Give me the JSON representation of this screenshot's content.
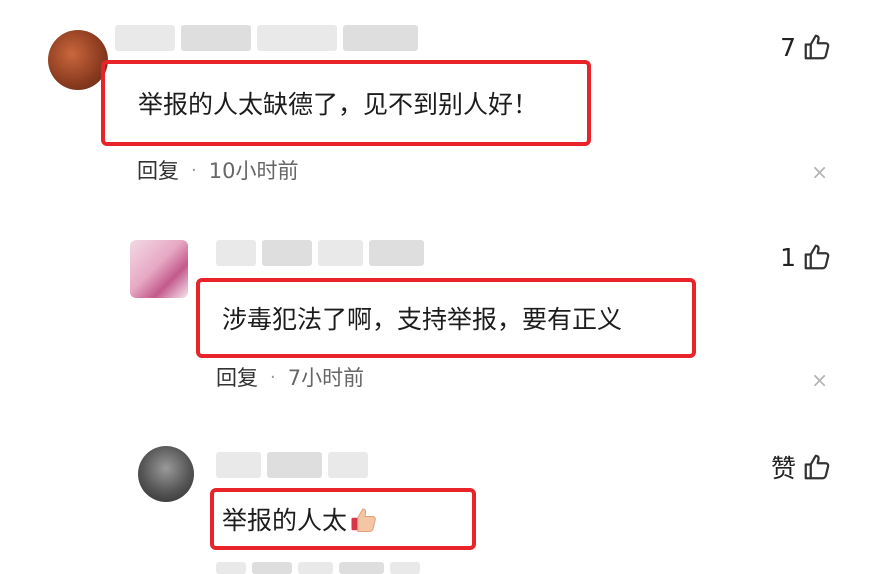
{
  "comments": [
    {
      "text": "举报的人太缺德了，见不到别人好！",
      "reply_label": "回复",
      "separator": "·",
      "time": "10小时前",
      "like_count": "7",
      "close_glyph": "×"
    },
    {
      "text": "涉毒犯法了啊，支持举报，要有正义",
      "reply_label": "回复",
      "separator": "·",
      "time": "7小时前",
      "like_count": "1",
      "close_glyph": "×"
    },
    {
      "text": "举报的人太",
      "like_label": "赞",
      "emoji": "thumbs-up-emoji"
    }
  ],
  "colors": {
    "highlight_border": "#e8232a",
    "meta_text": "#666666",
    "icon": "#333333"
  },
  "icons": {
    "like": "thumbs-up-icon",
    "close": "close-icon"
  }
}
